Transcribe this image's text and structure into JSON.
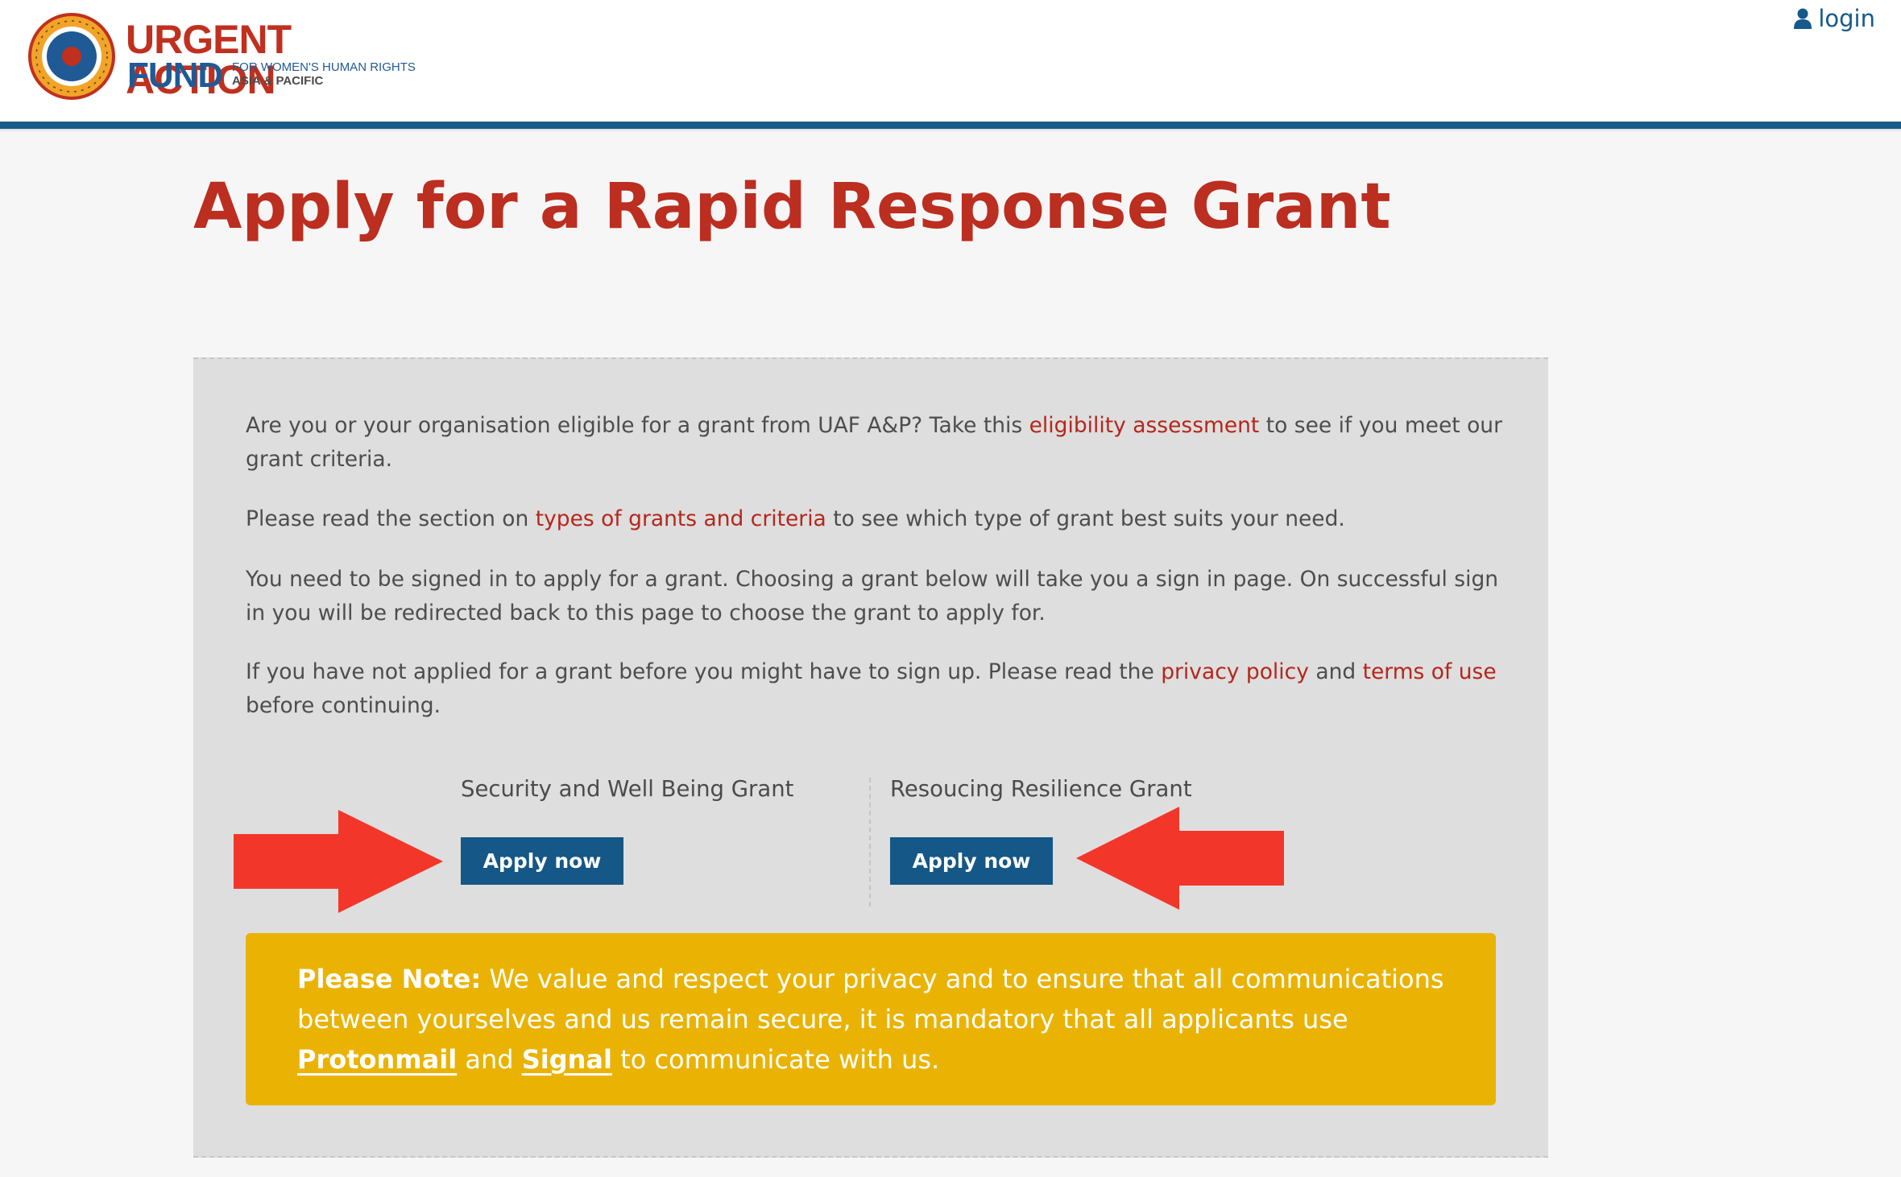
{
  "header": {
    "logo": {
      "line1": "URGENT ACTION",
      "line2": "FUND",
      "tagline1": "FOR WOMEN'S HUMAN RIGHTS",
      "tagline2": "ASIA & PACIFIC"
    },
    "login_label": "login",
    "login_icon": "user-icon"
  },
  "colors": {
    "brand_blue": "#155a8a",
    "title_red": "#bb2e20",
    "link_red": "#b5261b",
    "note_yellow": "#eab303",
    "arrow_red": "#f2372a",
    "button_blue": "#155786"
  },
  "main": {
    "title": "Apply for a Rapid Response Grant",
    "paragraphs": {
      "p1_before": "Are you or your organisation eligible for a grant from UAF A&P? Take this ",
      "p1_link": "eligibility assessment",
      "p1_after": " to see if you meet our grant criteria.",
      "p2_before": "Please read the section on ",
      "p2_link": "types of grants and criteria",
      "p2_after": " to see which type of grant best suits your need.",
      "p3": "You need to be signed in to apply for a grant. Choosing a grant below will take you a sign in page. On successful sign in you will be redirected back to this page to choose the grant to apply for.",
      "p4_before": "If you have not applied for a grant before you might have to sign up. Please read the ",
      "p4_link1": "privacy policy",
      "p4_mid": " and ",
      "p4_link2": "terms of use",
      "p4_after": " before continuing."
    },
    "grants": [
      {
        "title": "Security and Well Being Grant",
        "button": "Apply now"
      },
      {
        "title": "Resoucing Resilience Grant",
        "button": "Apply now"
      }
    ],
    "note": {
      "label": "Please Note:",
      "text": " We value and respect your privacy and to ensure that all communications between yourselves and us remain secure, it is mandatory that all applicants use ",
      "link1": "Protonmail",
      "mid": " and ",
      "link2": "Signal",
      "after": " to communicate with us."
    }
  }
}
